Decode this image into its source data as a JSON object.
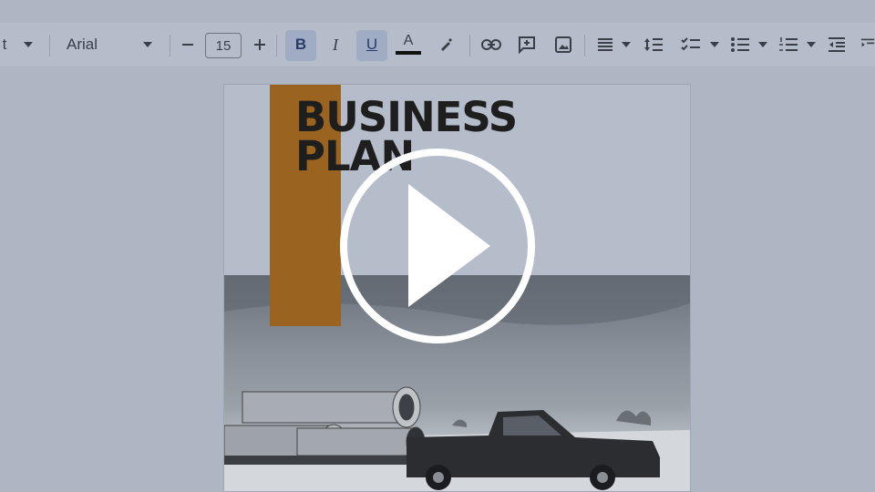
{
  "toolbar": {
    "font_style": "t",
    "font_name": "Arial",
    "font_size": "15",
    "bold_label": "B",
    "italic_label": "I",
    "underline_label": "U",
    "text_color_label": "A",
    "text_color": "#111111",
    "icons": [
      "caret-down-icon",
      "minus-icon",
      "plus-icon",
      "bold-icon",
      "italic-icon",
      "underline-icon",
      "text-color-icon",
      "highlight-pen-icon",
      "link-icon",
      "add-comment-icon",
      "insert-image-icon",
      "align-icon",
      "line-spacing-icon",
      "checklist-icon",
      "bulleted-list-icon",
      "numbered-list-icon",
      "decrease-indent-icon",
      "increase-indent-icon"
    ]
  },
  "document": {
    "title_line1": "BUSINESS",
    "title_line2": "PLAN",
    "accent_color": "#9a6420"
  },
  "overlay": {
    "icon": "play-icon"
  }
}
